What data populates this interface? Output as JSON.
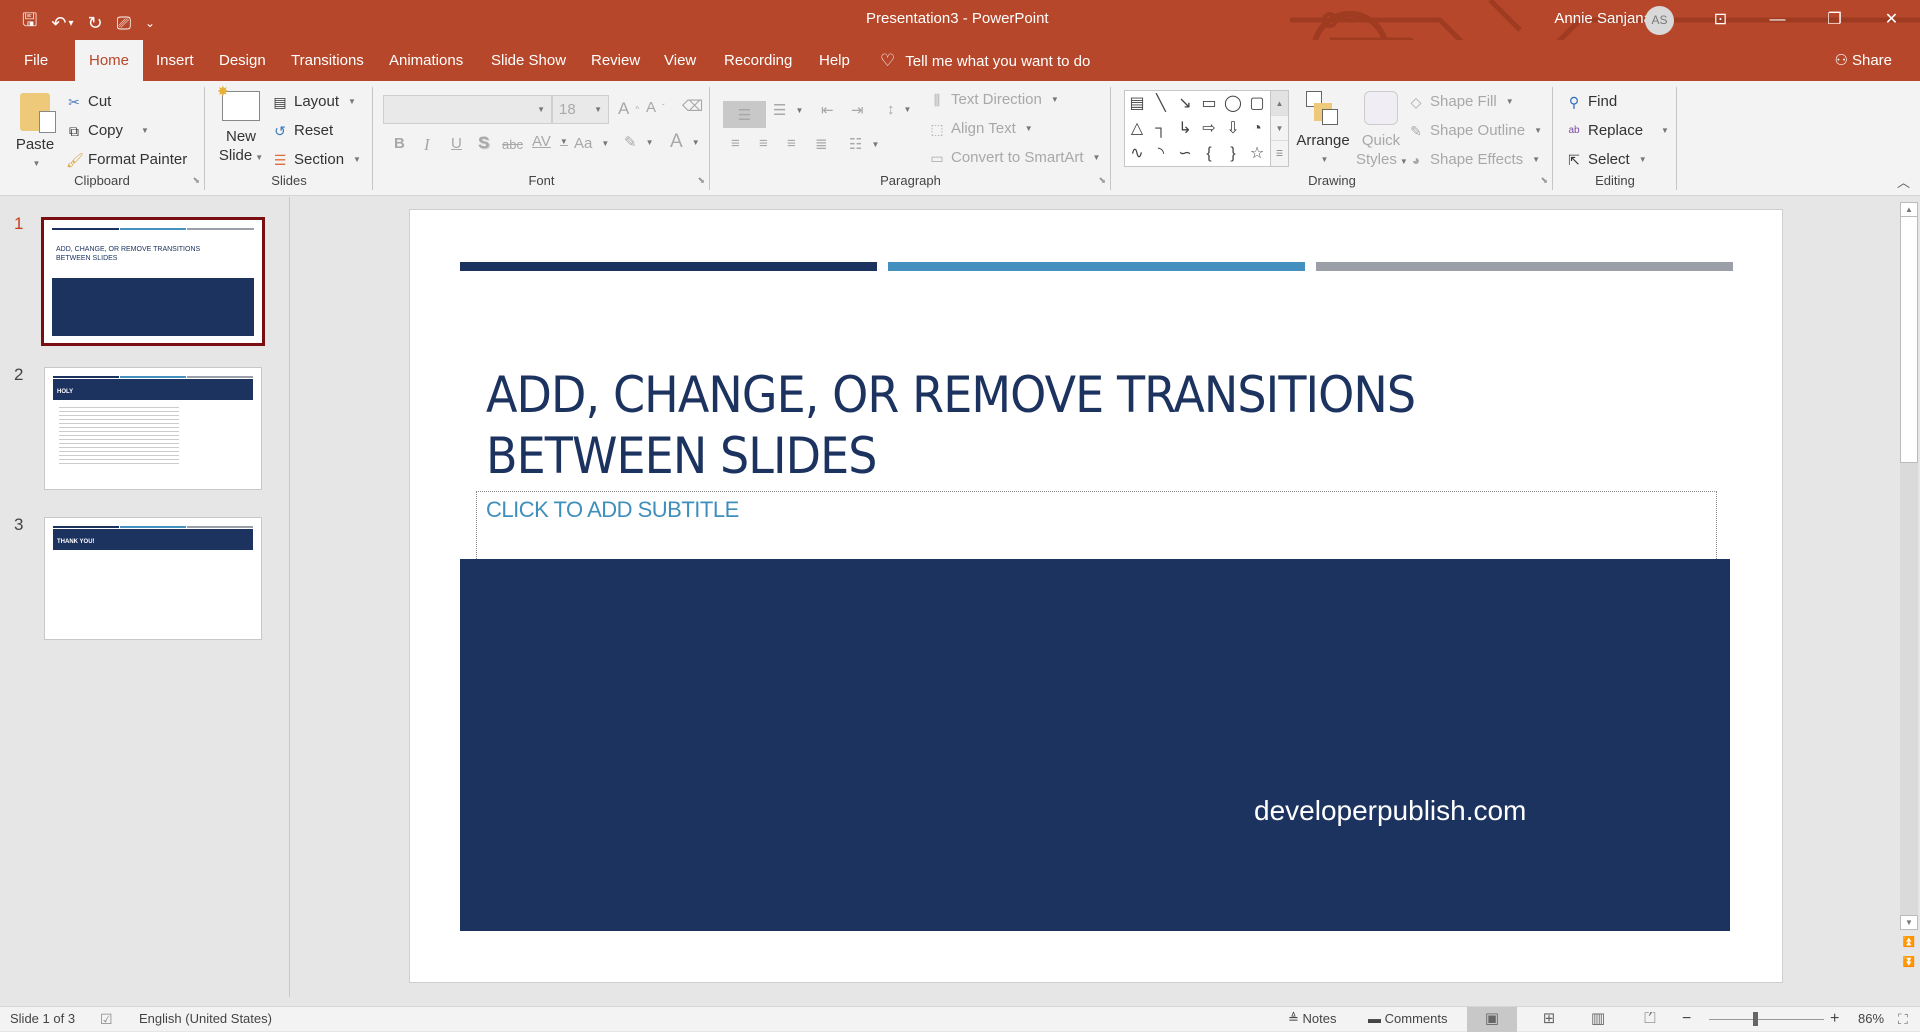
{
  "app": {
    "document_title": "Presentation3  -  PowerPoint",
    "user_name": "Annie Sanjana",
    "user_initials": "AS",
    "accent_color": "#b7472a"
  },
  "quick_access": [
    {
      "icon": "save-icon",
      "glyph": "🖫"
    },
    {
      "icon": "undo-icon",
      "glyph": "↶"
    },
    {
      "icon": "undo-dropdown-icon",
      "glyph": "▾"
    },
    {
      "icon": "redo-icon",
      "glyph": "↻"
    },
    {
      "icon": "present-from-beginning-icon",
      "glyph": "⎚"
    },
    {
      "icon": "customize-qat-icon",
      "glyph": "⌄"
    }
  ],
  "window_controls": {
    "ribbon_display": "⊡",
    "minimize": "—",
    "restore": "❐",
    "close": "✕"
  },
  "tabs": [
    {
      "label": "File"
    },
    {
      "label": "Home",
      "active": true
    },
    {
      "label": "Insert"
    },
    {
      "label": "Design"
    },
    {
      "label": "Transitions"
    },
    {
      "label": "Animations"
    },
    {
      "label": "Slide Show"
    },
    {
      "label": "Review"
    },
    {
      "label": "View"
    },
    {
      "label": "Recording"
    },
    {
      "label": "Help"
    }
  ],
  "tell_me": "Tell me what you want to do",
  "share_label": "Share",
  "ribbon": {
    "clipboard": {
      "label": "Clipboard",
      "paste": "Paste",
      "cut": "Cut",
      "copy": "Copy",
      "format_painter": "Format Painter"
    },
    "slides": {
      "label": "Slides",
      "new_slide_1": "New",
      "new_slide_2": "Slide",
      "layout": "Layout",
      "reset": "Reset",
      "section": "Section"
    },
    "font": {
      "label": "Font",
      "font_name": "",
      "font_size": "18",
      "bold": "B",
      "italic": "I",
      "underline": "U",
      "shadow": "S",
      "strike": "abc",
      "spacing": "AV",
      "case": "Aa",
      "grow": "A",
      "shrink": "A",
      "color": "A"
    },
    "paragraph": {
      "label": "Paragraph",
      "text_direction": "Text Direction",
      "align_text": "Align Text",
      "convert_smartart": "Convert to SmartArt"
    },
    "drawing": {
      "label": "Drawing",
      "arrange": "Arrange",
      "quick_styles_1": "Quick",
      "quick_styles_2": "Styles",
      "shape_fill": "Shape Fill",
      "shape_outline": "Shape Outline",
      "shape_effects": "Shape Effects",
      "shapes": [
        "▤",
        "╲",
        "↘",
        "▭",
        "◯",
        "▢",
        "△",
        "┐",
        "↳",
        "⇨",
        "⇩",
        "◔",
        "∿",
        "◝",
        "∽",
        "{",
        "}",
        "☆"
      ]
    },
    "editing": {
      "label": "Editing",
      "find": "Find",
      "replace": "Replace",
      "select": "Select"
    }
  },
  "slides_panel": [
    {
      "number": "1",
      "title": "ADD, CHANGE, OR REMOVE TRANSITIONS BETWEEN SLIDES",
      "active": true
    },
    {
      "number": "2",
      "title": "HOLY"
    },
    {
      "number": "3",
      "title": "THANK YOU!"
    }
  ],
  "slide": {
    "title_line1": "ADD, CHANGE, OR REMOVE TRANSITIONS",
    "title_line2": "BETWEEN SLIDES",
    "subtitle_placeholder": "CLICK TO ADD SUBTITLE",
    "watermark": "developerpublish.com",
    "colors": {
      "navy": "#1c3360",
      "blue": "#4490bf",
      "gray": "#9ba0a8"
    }
  },
  "status": {
    "slide_counter": "Slide 1 of 3",
    "language": "English (United States)",
    "notes": "Notes",
    "comments": "Comments",
    "zoom_level": "86%",
    "zoom_percent": 86
  }
}
